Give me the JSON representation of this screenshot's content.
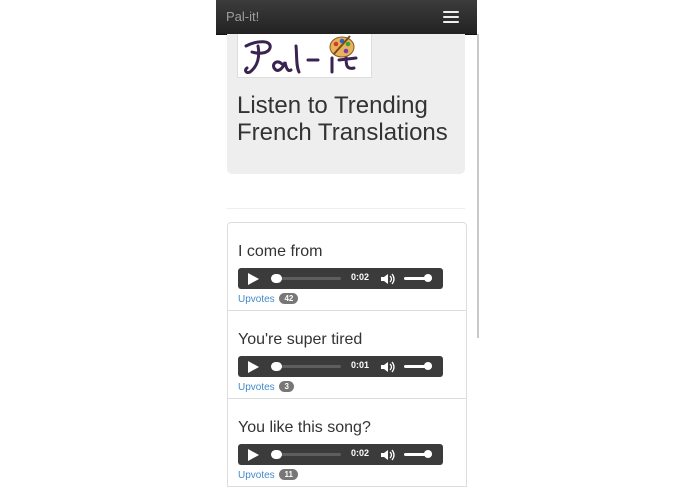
{
  "navbar": {
    "brand": "Pal-it!",
    "menu_icon": "hamburger-icon"
  },
  "jumbotron": {
    "logo_text": "Pal -it",
    "title": "Listen to Trending French Translations"
  },
  "translations": [
    {
      "phrase": "I come from",
      "time": "0:02",
      "upvotes_label": "Upvotes",
      "upvotes": "42"
    },
    {
      "phrase": "You're super tired",
      "time": "0:01",
      "upvotes_label": "Upvotes",
      "upvotes": "3"
    },
    {
      "phrase": "You like this song?",
      "time": "0:02",
      "upvotes_label": "Upvotes",
      "upvotes": "11"
    }
  ],
  "colors": {
    "navbar": "#222222",
    "jumbotron": "#eeeeee",
    "link": "#428bca",
    "player": "#3b3b3b"
  }
}
